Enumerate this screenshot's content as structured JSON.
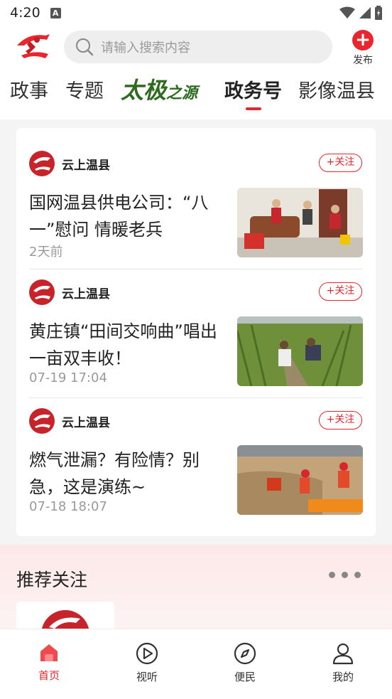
{
  "status_bar": {
    "time": "4:20"
  },
  "header": {
    "search_placeholder": "请输入搜索内容",
    "publish_label": "发布"
  },
  "tabs": [
    {
      "label": "政事"
    },
    {
      "label": "专题"
    },
    {
      "label": "太极之源",
      "brush": true
    },
    {
      "label": "政务号",
      "active": true
    },
    {
      "label": "影像温县"
    }
  ],
  "feed": [
    {
      "source": "云上温县",
      "follow_label": "+关注",
      "title": "国网温县供电公司：“八一”慰问 情暖老兵",
      "time": "2天前"
    },
    {
      "source": "云上温县",
      "follow_label": "+关注",
      "title": "黄庄镇“田间交响曲”唱出一亩双丰收！",
      "time": "07-19 17:04"
    },
    {
      "source": "云上温县",
      "follow_label": "+关注",
      "title": "燃气泄漏？有险情？别急，这是演练~",
      "time": "07-18 18:07"
    }
  ],
  "recommend": {
    "title": "推荐关注"
  },
  "bottom_nav": [
    {
      "label": "首页",
      "icon": "home-icon",
      "active": true
    },
    {
      "label": "视听",
      "icon": "play-icon"
    },
    {
      "label": "便民",
      "icon": "compass-icon"
    },
    {
      "label": "我的",
      "icon": "user-icon"
    }
  ],
  "colors": {
    "accent": "#e8262d",
    "brush_green": "#2f6b1f"
  }
}
